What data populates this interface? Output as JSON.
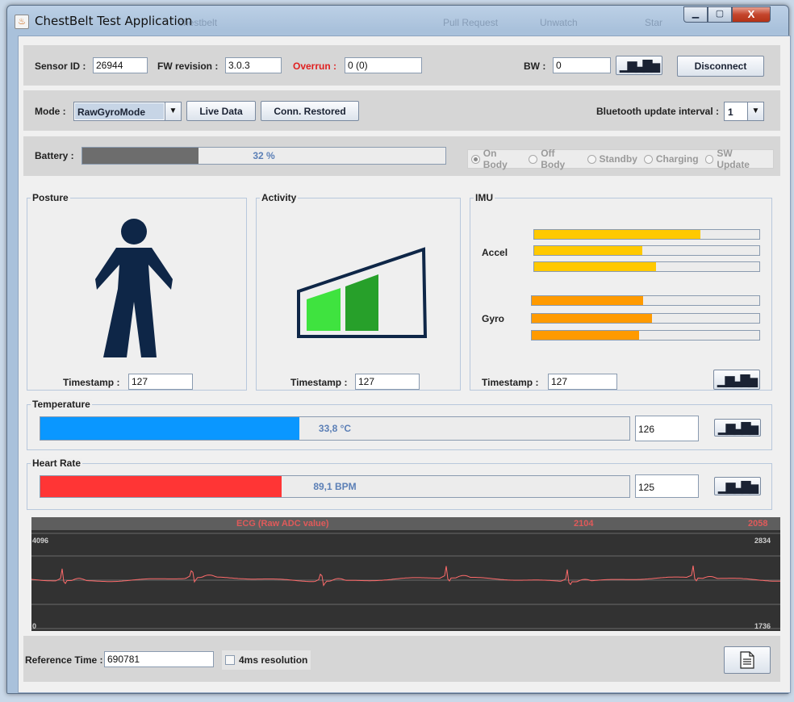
{
  "window": {
    "title": "ChestBelt Test Application",
    "icon": "java-cup-icon",
    "bg_ghost": [
      "chestbelt",
      "Pull Request",
      "Unwatch",
      "Star"
    ],
    "controls": {
      "minimize": "▁",
      "maximize": "▢",
      "close": "X"
    }
  },
  "toolbar": {
    "sensor_id_label": "Sensor ID :",
    "sensor_id_value": "26944",
    "fw_label": "FW revision :",
    "fw_value": "3.0.3",
    "overrun_label": "Overrun :",
    "overrun_value": "0 (0)",
    "bw_label": "BW :",
    "bw_value": "0",
    "bw_chart_icon": "bar-chart-icon",
    "disconnect_label": "Disconnect"
  },
  "mode_bar": {
    "mode_label": "Mode :",
    "mode_value": "RawGyroMode",
    "live_data_label": "Live Data",
    "conn_restored_label": "Conn. Restored",
    "bt_interval_label": "Bluetooth update interval :",
    "bt_interval_value": "1"
  },
  "battery": {
    "label": "Battery :",
    "percent": 32,
    "text": "32 %",
    "fill_color": "#6d6d6d",
    "states": [
      {
        "label": "On Body",
        "selected": true
      },
      {
        "label": "Off Body",
        "selected": false
      },
      {
        "label": "Standby",
        "selected": false
      },
      {
        "label": "Charging",
        "selected": false
      },
      {
        "label": "SW Update",
        "selected": false
      }
    ]
  },
  "posture": {
    "title": "Posture",
    "figure_icon": "standing-person-icon",
    "figure_color": "#0e2647",
    "timestamp_label": "Timestamp :",
    "timestamp_value": "127"
  },
  "activity": {
    "title": "Activity",
    "level_icon": "activity-level-icon",
    "frame_color": "#0e2647",
    "bar_colors": [
      "#3fe33f",
      "#27a02a"
    ],
    "timestamp_label": "Timestamp :",
    "timestamp_value": "127"
  },
  "imu": {
    "title": "IMU",
    "accel_label": "Accel",
    "gyro_label": "Gyro",
    "accel_color": "#ffc900",
    "gyro_color": "#ff9a00",
    "accel_levels": [
      0.74,
      0.48,
      0.54
    ],
    "gyro_levels": [
      0.49,
      0.53,
      0.47
    ],
    "timestamp_label": "Timestamp :",
    "timestamp_value": "127",
    "chart_icon": "bar-chart-icon"
  },
  "temperature": {
    "title": "Temperature",
    "fraction": 0.44,
    "text": "33,8 °C",
    "fill_color": "#0a97ff",
    "value": "126",
    "chart_icon": "bar-chart-icon"
  },
  "heart_rate": {
    "title": "Heart Rate",
    "fraction": 0.41,
    "text": "89,1 BPM",
    "fill_color": "#ff3535",
    "value": "125",
    "chart_icon": "bar-chart-icon"
  },
  "ecg": {
    "title": "ECG (Raw ADC value)",
    "current_value": "2104",
    "right_value": "2058",
    "y_max_left": "4096",
    "y_min_left": "0",
    "y_max_right": "2834",
    "y_min_right": "1736",
    "line_color": "#ff6b6b"
  },
  "footer": {
    "ref_time_label": "Reference Time :",
    "ref_time_value": "690781",
    "resolution_label": "4ms resolution",
    "resolution_checked": false,
    "export_icon": "document-icon"
  }
}
